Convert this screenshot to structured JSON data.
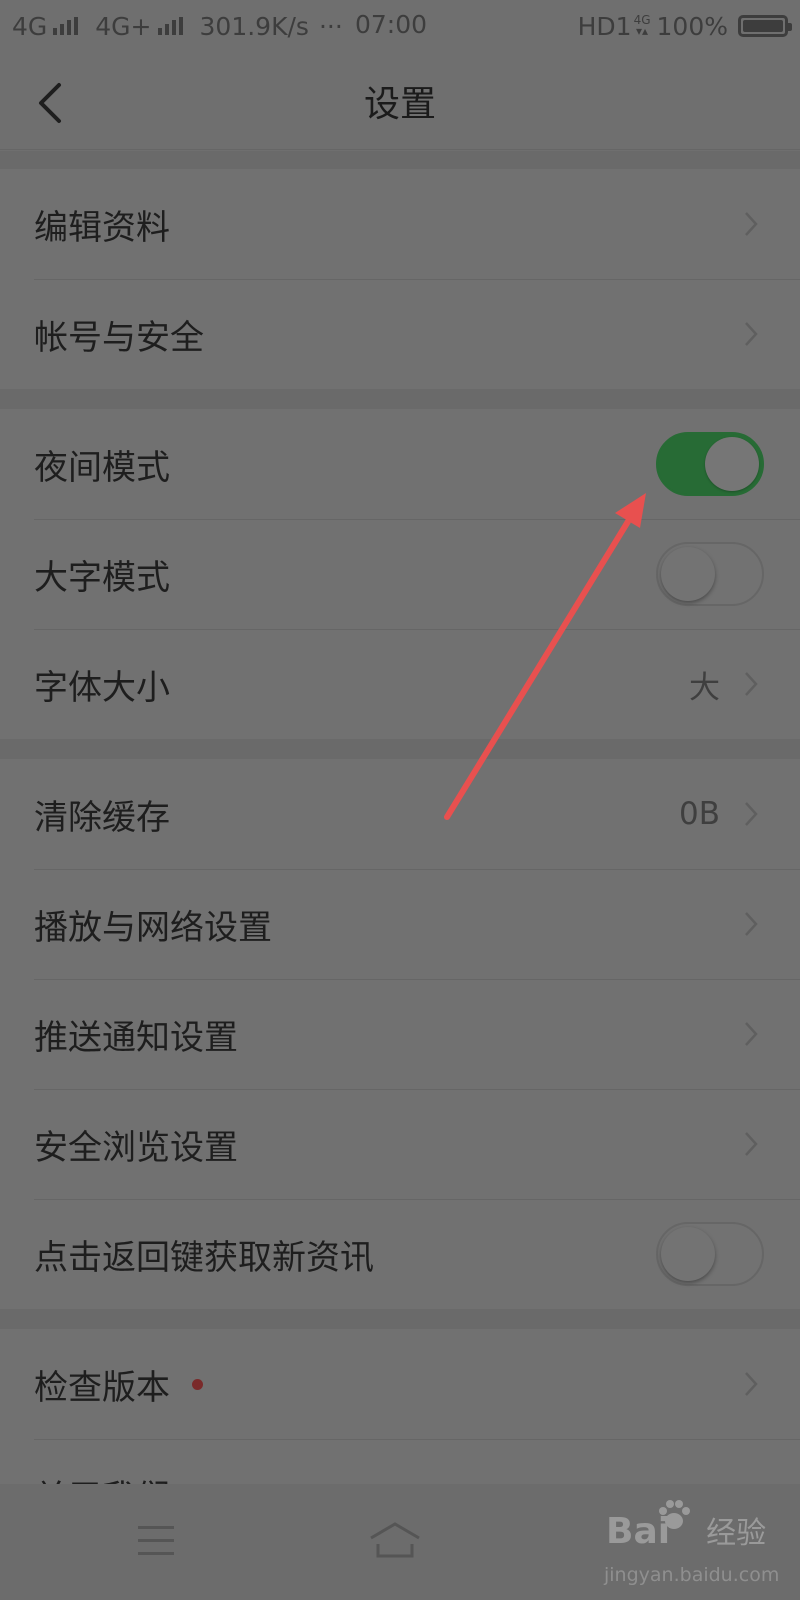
{
  "status_bar": {
    "sim1": "4G",
    "sim2": "4G+",
    "speed": "301.9K/s",
    "more": "···",
    "time": "07:00",
    "hd": "HD1",
    "net_badge": "4G",
    "battery": "100%"
  },
  "header": {
    "title": "设置"
  },
  "sections": {
    "account": {
      "items": [
        {
          "label": "编辑资料"
        },
        {
          "label": "帐号与安全"
        }
      ]
    },
    "display": {
      "items": [
        {
          "label": "夜间模式",
          "toggle_on": true
        },
        {
          "label": "大字模式",
          "toggle_on": false
        },
        {
          "label": "字体大小",
          "value": "大"
        }
      ]
    },
    "general": {
      "items": [
        {
          "label": "清除缓存",
          "value": "0B"
        },
        {
          "label": "播放与网络设置"
        },
        {
          "label": "推送通知设置"
        },
        {
          "label": "安全浏览设置"
        },
        {
          "label": "点击返回键获取新资讯",
          "toggle_on": false
        }
      ]
    },
    "about": {
      "items": [
        {
          "label": "检查版本",
          "has_red_dot": true
        },
        {
          "label": "关于我们"
        }
      ]
    }
  },
  "watermark": {
    "brand": "Bai",
    "brand_cn": "经验",
    "url": "jingyan.baidu.com"
  },
  "colors": {
    "toggle_on": "#276b35",
    "annotation_arrow": "#e8504f",
    "red_dot": "#7a2a2a"
  },
  "icons": [
    "back-arrow-icon",
    "chevron-right-icon",
    "menu-icon",
    "home-icon",
    "baidu-paw-icon"
  ]
}
